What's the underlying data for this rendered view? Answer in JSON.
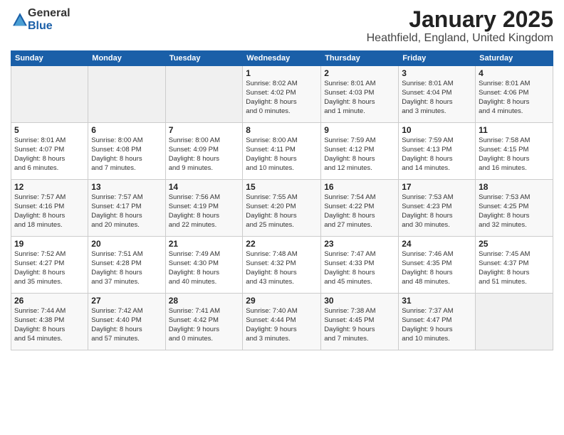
{
  "header": {
    "logo_general": "General",
    "logo_blue": "Blue",
    "month_title": "January 2025",
    "location": "Heathfield, England, United Kingdom"
  },
  "weekdays": [
    "Sunday",
    "Monday",
    "Tuesday",
    "Wednesday",
    "Thursday",
    "Friday",
    "Saturday"
  ],
  "weeks": [
    [
      {
        "day": "",
        "info": ""
      },
      {
        "day": "",
        "info": ""
      },
      {
        "day": "",
        "info": ""
      },
      {
        "day": "1",
        "info": "Sunrise: 8:02 AM\nSunset: 4:02 PM\nDaylight: 8 hours\nand 0 minutes."
      },
      {
        "day": "2",
        "info": "Sunrise: 8:01 AM\nSunset: 4:03 PM\nDaylight: 8 hours\nand 1 minute."
      },
      {
        "day": "3",
        "info": "Sunrise: 8:01 AM\nSunset: 4:04 PM\nDaylight: 8 hours\nand 3 minutes."
      },
      {
        "day": "4",
        "info": "Sunrise: 8:01 AM\nSunset: 4:06 PM\nDaylight: 8 hours\nand 4 minutes."
      }
    ],
    [
      {
        "day": "5",
        "info": "Sunrise: 8:01 AM\nSunset: 4:07 PM\nDaylight: 8 hours\nand 6 minutes."
      },
      {
        "day": "6",
        "info": "Sunrise: 8:00 AM\nSunset: 4:08 PM\nDaylight: 8 hours\nand 7 minutes."
      },
      {
        "day": "7",
        "info": "Sunrise: 8:00 AM\nSunset: 4:09 PM\nDaylight: 8 hours\nand 9 minutes."
      },
      {
        "day": "8",
        "info": "Sunrise: 8:00 AM\nSunset: 4:11 PM\nDaylight: 8 hours\nand 10 minutes."
      },
      {
        "day": "9",
        "info": "Sunrise: 7:59 AM\nSunset: 4:12 PM\nDaylight: 8 hours\nand 12 minutes."
      },
      {
        "day": "10",
        "info": "Sunrise: 7:59 AM\nSunset: 4:13 PM\nDaylight: 8 hours\nand 14 minutes."
      },
      {
        "day": "11",
        "info": "Sunrise: 7:58 AM\nSunset: 4:15 PM\nDaylight: 8 hours\nand 16 minutes."
      }
    ],
    [
      {
        "day": "12",
        "info": "Sunrise: 7:57 AM\nSunset: 4:16 PM\nDaylight: 8 hours\nand 18 minutes."
      },
      {
        "day": "13",
        "info": "Sunrise: 7:57 AM\nSunset: 4:17 PM\nDaylight: 8 hours\nand 20 minutes."
      },
      {
        "day": "14",
        "info": "Sunrise: 7:56 AM\nSunset: 4:19 PM\nDaylight: 8 hours\nand 22 minutes."
      },
      {
        "day": "15",
        "info": "Sunrise: 7:55 AM\nSunset: 4:20 PM\nDaylight: 8 hours\nand 25 minutes."
      },
      {
        "day": "16",
        "info": "Sunrise: 7:54 AM\nSunset: 4:22 PM\nDaylight: 8 hours\nand 27 minutes."
      },
      {
        "day": "17",
        "info": "Sunrise: 7:53 AM\nSunset: 4:23 PM\nDaylight: 8 hours\nand 30 minutes."
      },
      {
        "day": "18",
        "info": "Sunrise: 7:53 AM\nSunset: 4:25 PM\nDaylight: 8 hours\nand 32 minutes."
      }
    ],
    [
      {
        "day": "19",
        "info": "Sunrise: 7:52 AM\nSunset: 4:27 PM\nDaylight: 8 hours\nand 35 minutes."
      },
      {
        "day": "20",
        "info": "Sunrise: 7:51 AM\nSunset: 4:28 PM\nDaylight: 8 hours\nand 37 minutes."
      },
      {
        "day": "21",
        "info": "Sunrise: 7:49 AM\nSunset: 4:30 PM\nDaylight: 8 hours\nand 40 minutes."
      },
      {
        "day": "22",
        "info": "Sunrise: 7:48 AM\nSunset: 4:32 PM\nDaylight: 8 hours\nand 43 minutes."
      },
      {
        "day": "23",
        "info": "Sunrise: 7:47 AM\nSunset: 4:33 PM\nDaylight: 8 hours\nand 45 minutes."
      },
      {
        "day": "24",
        "info": "Sunrise: 7:46 AM\nSunset: 4:35 PM\nDaylight: 8 hours\nand 48 minutes."
      },
      {
        "day": "25",
        "info": "Sunrise: 7:45 AM\nSunset: 4:37 PM\nDaylight: 8 hours\nand 51 minutes."
      }
    ],
    [
      {
        "day": "26",
        "info": "Sunrise: 7:44 AM\nSunset: 4:38 PM\nDaylight: 8 hours\nand 54 minutes."
      },
      {
        "day": "27",
        "info": "Sunrise: 7:42 AM\nSunset: 4:40 PM\nDaylight: 8 hours\nand 57 minutes."
      },
      {
        "day": "28",
        "info": "Sunrise: 7:41 AM\nSunset: 4:42 PM\nDaylight: 9 hours\nand 0 minutes."
      },
      {
        "day": "29",
        "info": "Sunrise: 7:40 AM\nSunset: 4:44 PM\nDaylight: 9 hours\nand 3 minutes."
      },
      {
        "day": "30",
        "info": "Sunrise: 7:38 AM\nSunset: 4:45 PM\nDaylight: 9 hours\nand 7 minutes."
      },
      {
        "day": "31",
        "info": "Sunrise: 7:37 AM\nSunset: 4:47 PM\nDaylight: 9 hours\nand 10 minutes."
      },
      {
        "day": "",
        "info": ""
      }
    ]
  ]
}
